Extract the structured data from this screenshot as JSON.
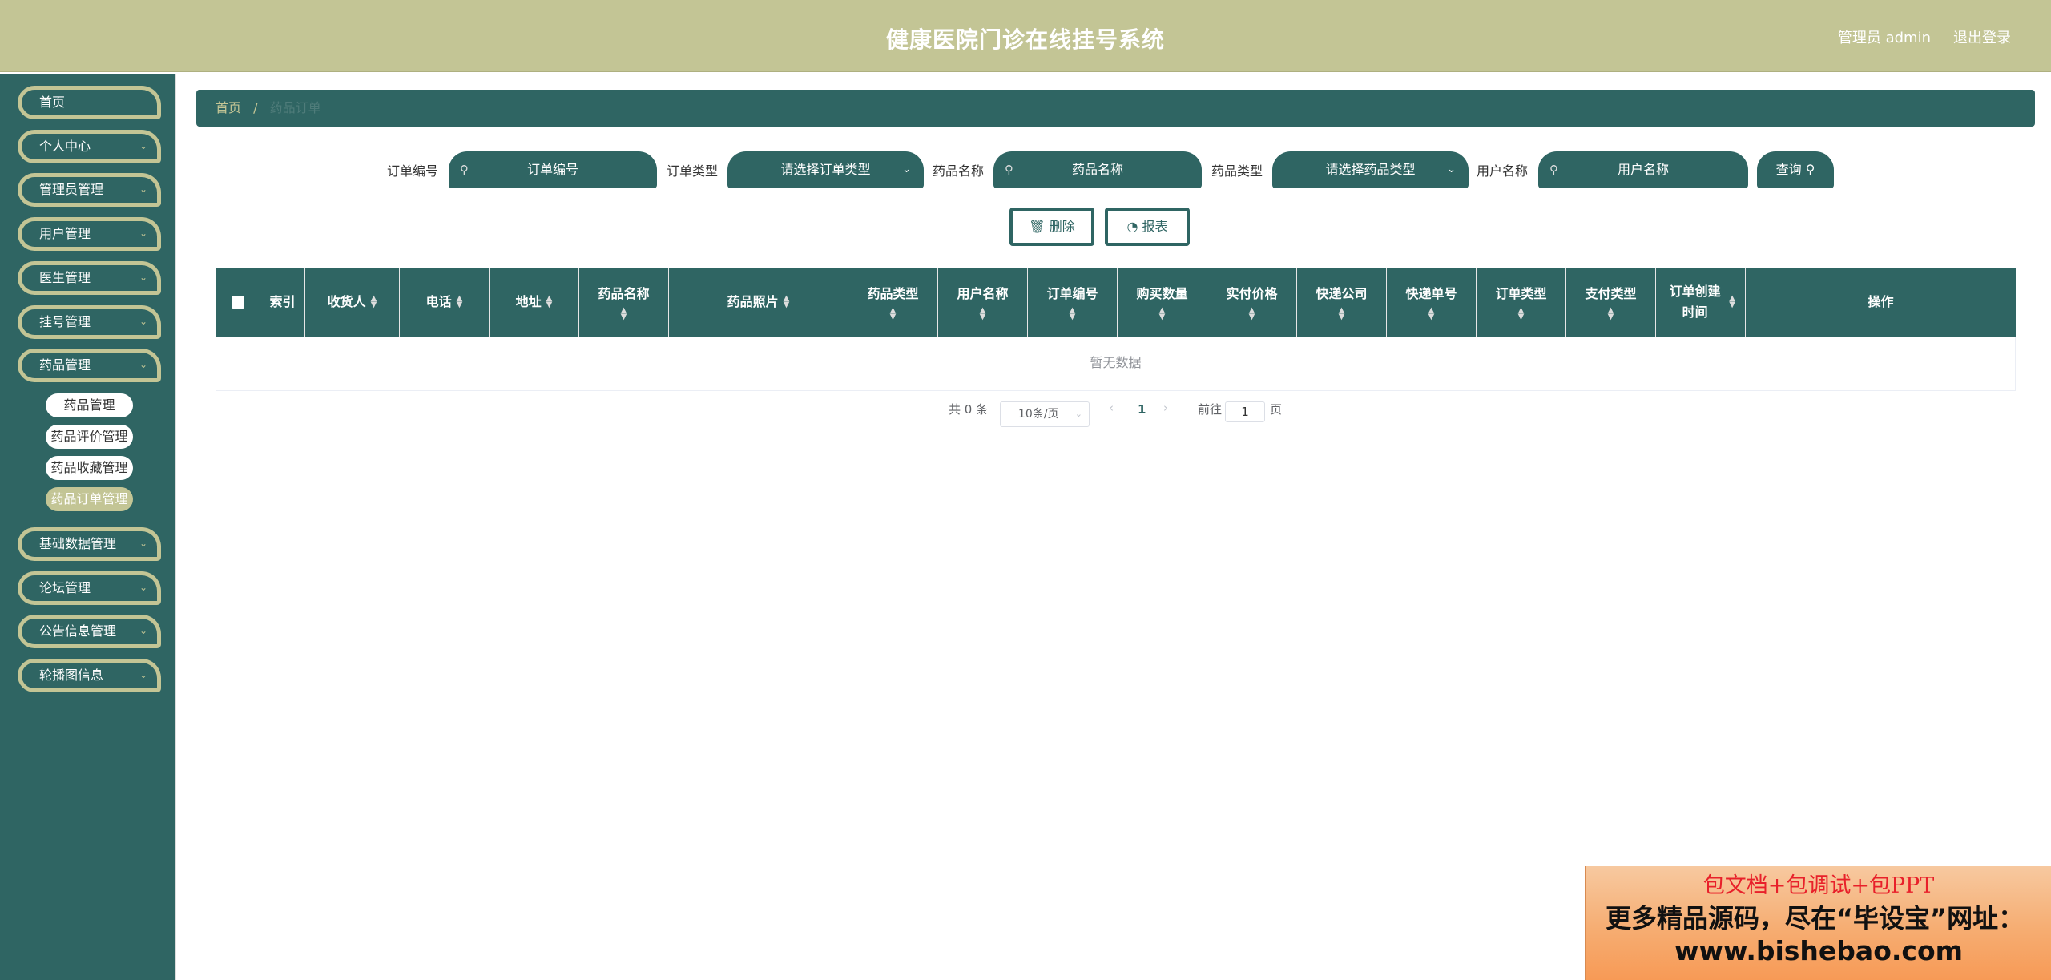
{
  "header": {
    "title": "健康医院门诊在线挂号系统",
    "user": "管理员 admin",
    "logout": "退出登录"
  },
  "sidebar": {
    "items": [
      {
        "label": "首页",
        "chevron": false
      },
      {
        "label": "个人中心",
        "chevron": true
      },
      {
        "label": "管理员管理",
        "chevron": true
      },
      {
        "label": "用户管理",
        "chevron": true
      },
      {
        "label": "医生管理",
        "chevron": true
      },
      {
        "label": "挂号管理",
        "chevron": true
      },
      {
        "label": "药品管理",
        "chevron": true
      },
      {
        "label": "基础数据管理",
        "chevron": true
      },
      {
        "label": "论坛管理",
        "chevron": true
      },
      {
        "label": "公告信息管理",
        "chevron": true
      },
      {
        "label": "轮播图信息",
        "chevron": true
      }
    ],
    "subitems": [
      {
        "label": "药品管理",
        "active": false
      },
      {
        "label": "药品评价管理",
        "active": false
      },
      {
        "label": "药品收藏管理",
        "active": false
      },
      {
        "label": "药品订单管理",
        "active": true
      }
    ]
  },
  "breadcrumb": {
    "home": "首页",
    "separator": "/",
    "current": "药品订单"
  },
  "filters": {
    "order_no_label": "订单编号",
    "order_no_placeholder": "订单编号",
    "order_type_label": "订单类型",
    "order_type_placeholder": "请选择订单类型",
    "drug_name_label": "药品名称",
    "drug_name_placeholder": "药品名称",
    "drug_type_label": "药品类型",
    "drug_type_placeholder": "请选择药品类型",
    "user_name_label": "用户名称",
    "user_name_placeholder": "用户名称",
    "query_label": "查询"
  },
  "actions": {
    "delete_label": "删除",
    "report_label": "报表"
  },
  "table": {
    "columns": [
      "索引",
      "收货人",
      "电话",
      "地址",
      "药品名称",
      "药品照片",
      "药品类型",
      "用户名称",
      "订单编号",
      "购买数量",
      "实付价格",
      "快递公司",
      "快递单号",
      "订单类型",
      "支付类型",
      "订单创建时间",
      "操作"
    ],
    "empty_text": "暂无数据"
  },
  "pagination": {
    "total": "共 0 条",
    "page_size": "10条/页",
    "current_page": "1",
    "goto_prefix": "前往",
    "goto_value": "1",
    "goto_suffix": "页"
  },
  "ad": {
    "line1": "包文档+包调试+包PPT",
    "line2": "更多精品源码，尽在“毕设宝”网址：",
    "line3": "www.bishebao.com"
  }
}
